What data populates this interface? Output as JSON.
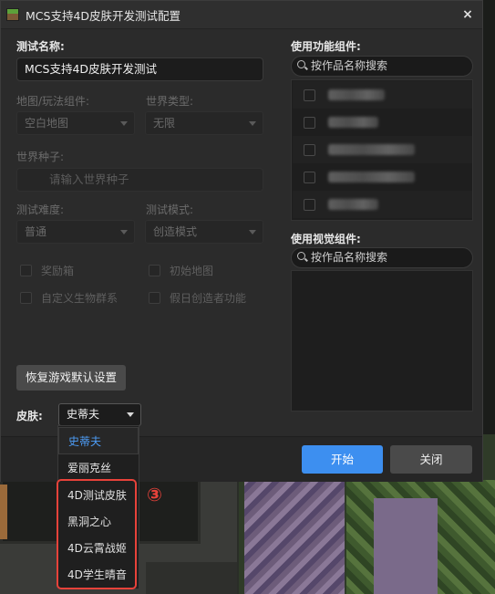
{
  "window": {
    "title": "MCS支持4D皮肤开发测试配置",
    "close_glyph": "×"
  },
  "left": {
    "test_name_label": "测试名称:",
    "test_name_value": "MCS支持4D皮肤开发测试",
    "map_label": "地图/玩法组件:",
    "map_value": "空白地图",
    "world_type_label": "世界类型:",
    "world_type_value": "无限",
    "seed_label": "世界种子:",
    "seed_placeholder": "请输入世界种子",
    "difficulty_label": "测试难度:",
    "difficulty_value": "普通",
    "mode_label": "测试模式:",
    "mode_value": "创造模式",
    "checkboxes": [
      "奖励箱",
      "初始地图",
      "自定义生物群系",
      "假日创造者功能"
    ],
    "reset_button": "恢复游戏默认设置",
    "skin_label": "皮肤:",
    "skin_value": "史蒂夫"
  },
  "right": {
    "components_label": "使用功能组件:",
    "components_search": "按作品名称搜索",
    "components_count": 5,
    "visual_label": "使用视觉组件:",
    "visual_search": "按作品名称搜索"
  },
  "footer": {
    "start_button": "开始",
    "close_button": "关闭"
  },
  "skin_dropdown": {
    "options": [
      "史蒂夫",
      "爱丽克丝",
      "4D测试皮肤",
      "黑洞之心",
      "4D云霄战姬",
      "4D学生晴音"
    ],
    "selected_index": 0
  },
  "annotation": {
    "marker": "③",
    "color": "#e8423a"
  },
  "colors": {
    "accent": "#3d8ff0",
    "selected_text": "#4d9cf5"
  }
}
